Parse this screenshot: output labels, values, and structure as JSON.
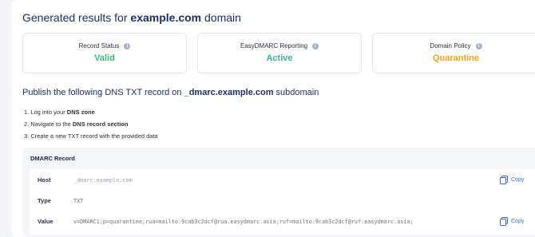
{
  "header": {
    "title_prefix": "Generated results for ",
    "domain": "example.com",
    "title_suffix": " domain"
  },
  "stats": [
    {
      "label": "Record Status",
      "value": "Valid",
      "color": "#37b883"
    },
    {
      "label": "EasyDMARC Reporting",
      "value": "Active",
      "color": "#37b883"
    },
    {
      "label": "Domain Policy",
      "value": "Quarantine",
      "color": "#f3a41c"
    }
  ],
  "publish": {
    "prefix": "Publish the following DNS TXT record on ",
    "host": "_dmarc.example.com",
    "suffix": " subdomain"
  },
  "steps": {
    "s1_prefix": "1. Log into your ",
    "s1_bold": "DNS zone",
    "s2_prefix": "2. Navigate to the ",
    "s2_bold": "DNS record section",
    "s3": "3. Create a new TXT record with the provided data"
  },
  "record": {
    "title": "DMARC Record",
    "host_label": "Host",
    "host_value": "_dmarc.example.com",
    "type_label": "Type",
    "type_value": "TXT",
    "value_label": "Value",
    "value_value": "v=DMARC1;p=quarantine;rua=mailto:9cab3c2dcf@rua.easydmarc.asia;ruf=mailto:9cab3c2dcf@ruf.easydmarc.asia;",
    "copy_label": "Copy",
    "info_icon": "info-icon",
    "copy_icon": "copy-icon"
  },
  "colors": {
    "accent": "#3c64e6",
    "title": "#1c2f6b",
    "success": "#37b883",
    "warning": "#f3a41c"
  }
}
